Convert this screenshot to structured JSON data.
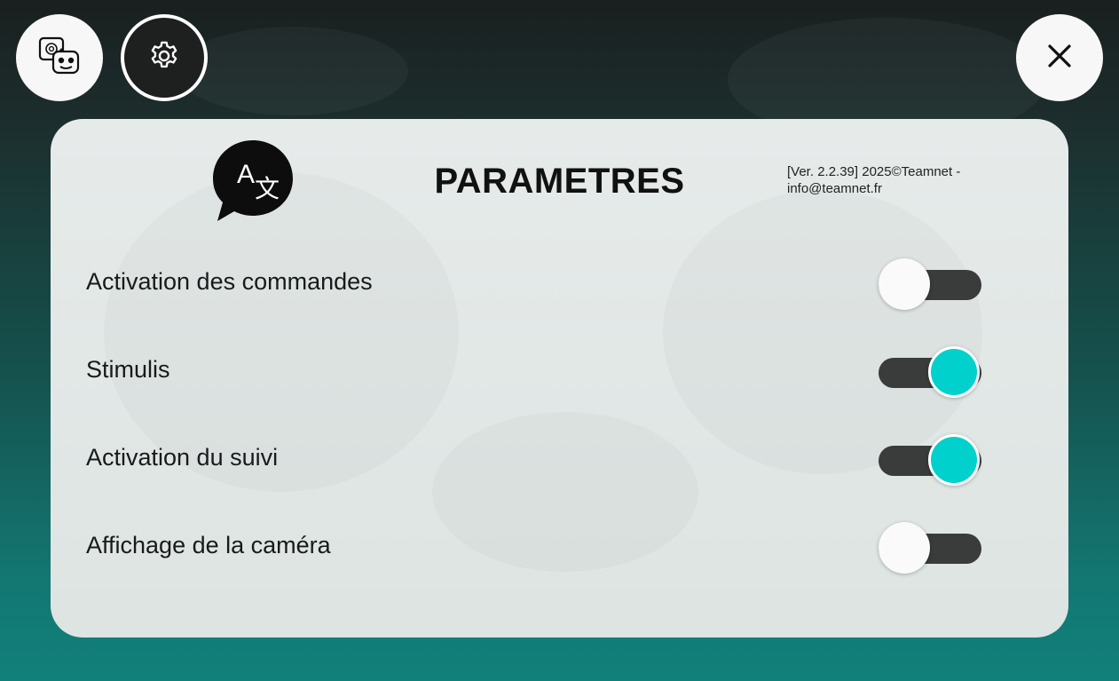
{
  "toolbar": {
    "robot_chat_icon": "robot-chat-icon",
    "settings_icon": "gear-icon",
    "close_icon": "close-icon"
  },
  "panel": {
    "title": "PARAMETRES",
    "version_text": "[Ver. 2.2.39] 2025©Teamnet - info@teamnet.fr",
    "language_icon": "translate-icon",
    "settings": [
      {
        "label": "Activation des commandes",
        "enabled": false
      },
      {
        "label": "Stimulis",
        "enabled": true
      },
      {
        "label": "Activation du suivi",
        "enabled": true
      },
      {
        "label": "Affichage de la caméra",
        "enabled": false
      }
    ]
  },
  "colors": {
    "accent": "#00d1cc",
    "track": "#3a3b3b",
    "panel": "#e3e8e7"
  }
}
